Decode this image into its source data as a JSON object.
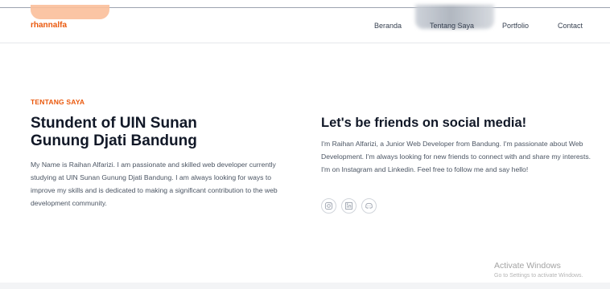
{
  "nav": {
    "brand": "rhannalfa",
    "links": [
      "Beranda",
      "Tentang Saya",
      "Portfolio",
      "Contact"
    ]
  },
  "about": {
    "eyebrow": "TENTANG SAYA",
    "title_line1": "Stundent of UIN Sunan",
    "title_line2": "Gunung Djati Bandung",
    "description": "My Name is Raihan Alfarizi. I am passionate and skilled web developer currently studying at UIN Sunan Gunung Djati Bandung. I am always looking for ways to improve my skills and is dedicated to making a significant contribution to the web development community."
  },
  "social": {
    "title": "Let's be friends on social media!",
    "description": "I'm Raihan Alfarizi, a Junior Web Developer from Bandung. I'm passionate about Web Development. I'm always looking for new friends to connect with and share my interests. I'm on Instagram and Linkedin. Feel free to follow me and say hello!",
    "icons": [
      "instagram-icon",
      "linkedin-icon",
      "discord-icon"
    ]
  },
  "watermark": {
    "title": "Activate Windows",
    "subtitle": "Go to Settings to activate Windows."
  },
  "colors": {
    "accent": "#ea580c",
    "heading": "#111827",
    "body_text": "#4b5563"
  }
}
